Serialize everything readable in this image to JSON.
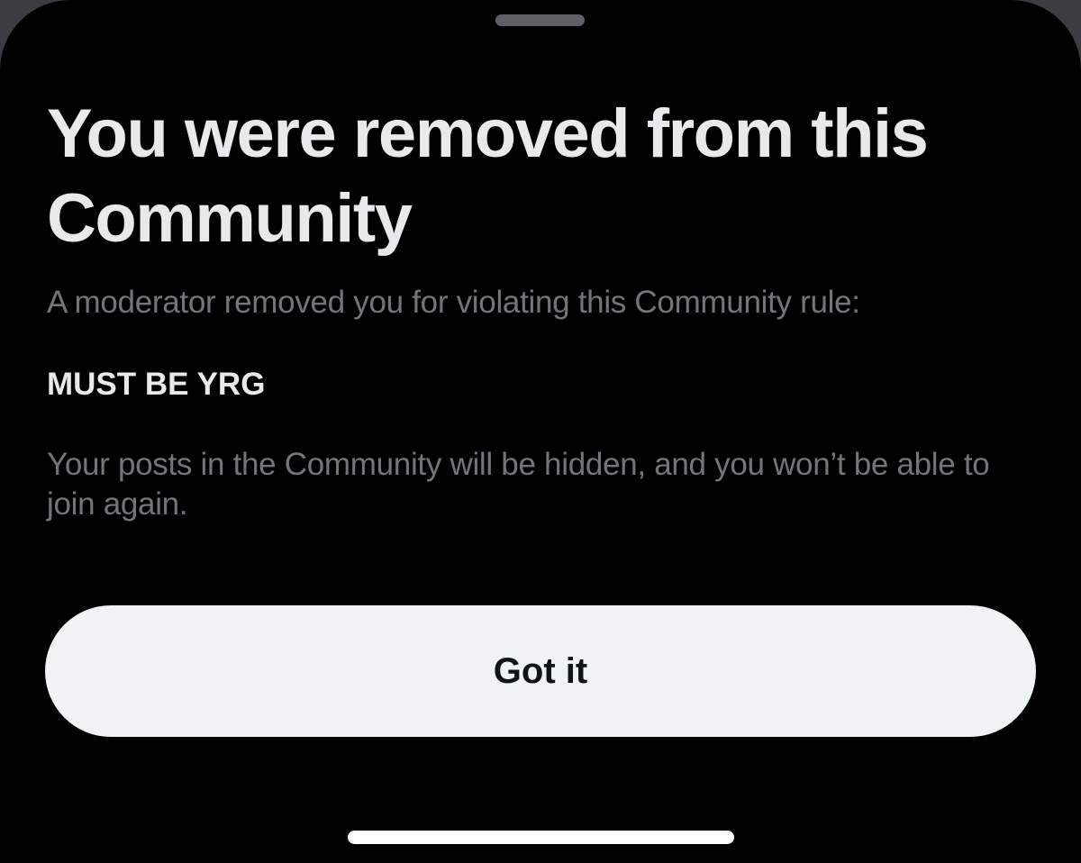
{
  "dialog": {
    "title": "You were removed from this Community",
    "subtitle": "A moderator removed you for violating this Community rule:",
    "rule_name": "MUST BE YRG",
    "consequence": "Your posts in the Community will be hidden, and you won’t be able to join again.",
    "confirm_label": "Got it"
  },
  "colors": {
    "background": "#000000",
    "title_text": "#e7e9ea",
    "secondary_text": "#71767b",
    "button_background": "#eff3f4",
    "button_text": "#0f1419"
  }
}
